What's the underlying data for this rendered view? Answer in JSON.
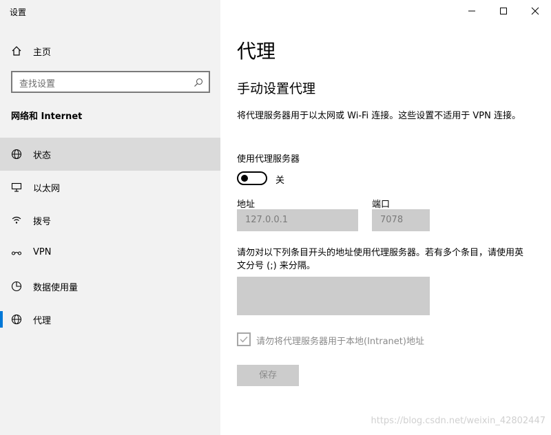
{
  "window": {
    "title": "设置"
  },
  "sidebar": {
    "home_label": "主页",
    "search_placeholder": "查找设置",
    "section_heading": "网络和 Internet",
    "items": [
      {
        "label": "状态",
        "icon": "globe-status-icon",
        "active": false
      },
      {
        "label": "以太网",
        "icon": "ethernet-icon",
        "active": false
      },
      {
        "label": "拨号",
        "icon": "dialup-icon",
        "active": false
      },
      {
        "label": "VPN",
        "icon": "vpn-icon",
        "active": false
      },
      {
        "label": "数据使用量",
        "icon": "data-usage-icon",
        "active": false
      },
      {
        "label": "代理",
        "icon": "globe-icon",
        "active": true
      }
    ]
  },
  "main": {
    "page_title": "代理",
    "sub_title": "手动设置代理",
    "description": "将代理服务器用于以太网或 Wi-Fi 连接。这些设置不适用于 VPN 连接。",
    "toggle_label": "使用代理服务器",
    "toggle_state": "关",
    "address_label": "地址",
    "address_value": "127.0.0.1",
    "port_label": "端口",
    "port_value": "7078",
    "exceptions_desc": "请勿对以下列条目开头的地址使用代理服务器。若有多个条目，请使用英文分号 (;) 来分隔。",
    "exceptions_value": "",
    "bypass_local_label": "请勿将代理服务器用于本地(Intranet)地址",
    "bypass_local_checked": true,
    "save_label": "保存"
  },
  "watermark": "https://blog.csdn.net/weixin_42802447",
  "colors": {
    "accent": "#0078d7",
    "sidebar_bg": "#f2f2f2",
    "active_bg": "#dadada",
    "disabled_field": "#cccccc"
  }
}
